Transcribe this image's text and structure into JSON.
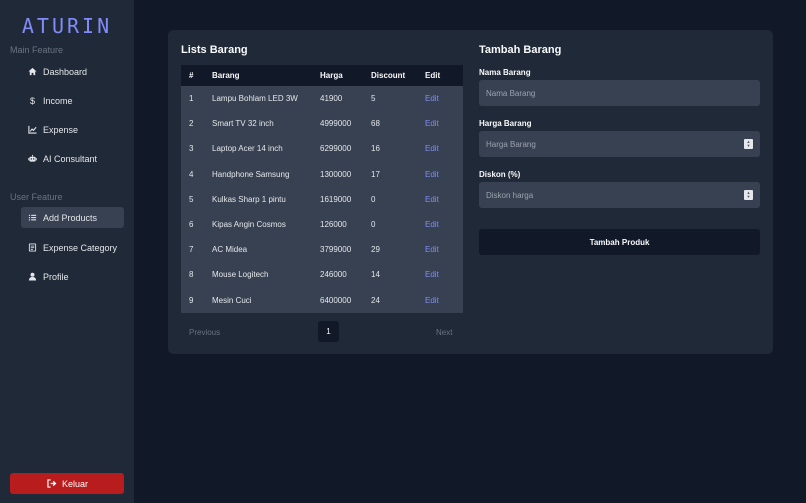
{
  "sidebar": {
    "logo": "ATURIN",
    "main_section": "Main Feature",
    "user_section": "User Feature",
    "main_items": [
      {
        "label": "Dashboard",
        "icon": "home-icon"
      },
      {
        "label": "Income",
        "icon": "dollar-icon"
      },
      {
        "label": "Expense",
        "icon": "chart-line-icon"
      },
      {
        "label": "AI Consultant",
        "icon": "robot-icon"
      }
    ],
    "user_items": [
      {
        "label": "Add Products",
        "icon": "list-icon",
        "active": true
      },
      {
        "label": "Expense Category",
        "icon": "document-icon"
      },
      {
        "label": "Profile",
        "icon": "user-icon"
      }
    ],
    "logout_label": "Keluar"
  },
  "list": {
    "title": "Lists Barang",
    "columns": [
      "#",
      "Barang",
      "Harga",
      "Discount",
      "Edit"
    ],
    "rows": [
      [
        "1",
        "Lampu Bohlam LED 3W",
        "41900",
        "5",
        "Edit"
      ],
      [
        "2",
        "Smart TV 32 inch",
        "4999000",
        "68",
        "Edit"
      ],
      [
        "3",
        "Laptop Acer 14 inch",
        "6299000",
        "16",
        "Edit"
      ],
      [
        "4",
        "Handphone Samsung",
        "1300000",
        "17",
        "Edit"
      ],
      [
        "5",
        "Kulkas Sharp 1 pintu",
        "1619000",
        "0",
        "Edit"
      ],
      [
        "6",
        "Kipas Angin Cosmos",
        "126000",
        "0",
        "Edit"
      ],
      [
        "7",
        "AC Midea",
        "3799000",
        "29",
        "Edit"
      ],
      [
        "8",
        "Mouse Logitech",
        "246000",
        "14",
        "Edit"
      ],
      [
        "9",
        "Mesin Cuci",
        "6400000",
        "24",
        "Edit"
      ]
    ],
    "pagination": {
      "previous": "Previous",
      "current": "1",
      "next": "Next"
    }
  },
  "form": {
    "title": "Tambah Barang",
    "name_label": "Nama Barang",
    "name_placeholder": "Nama Barang",
    "price_label": "Harga Barang",
    "price_placeholder": "Harga Barang",
    "discount_label": "Diskon (%)",
    "discount_placeholder": "Diskon harga",
    "submit_label": "Tambah Produk"
  },
  "colors": {
    "background": "#111827",
    "panel": "#1f2937",
    "row": "#374151",
    "accent": "#818cf8",
    "logout": "#b91c1c"
  }
}
